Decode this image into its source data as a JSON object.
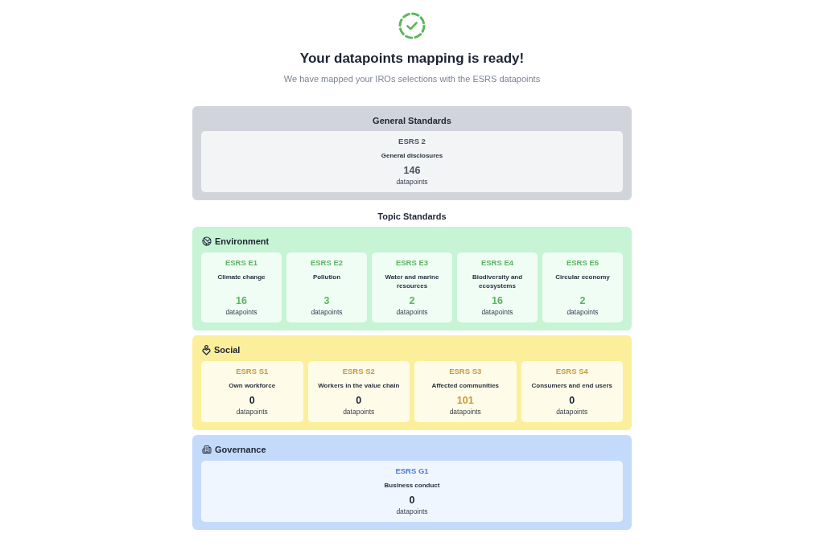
{
  "header": {
    "title": "Your datapoints mapping is ready!",
    "subtitle": "We have mapped your IROs selections with the ESRS datapoints"
  },
  "general_standards": {
    "title": "General Standards",
    "cards": [
      {
        "code": "ESRS 2",
        "label": "General disclosures",
        "count": "146",
        "unit": "datapoints",
        "highlighted": true
      }
    ]
  },
  "topic_standards": {
    "title": "Topic Standards",
    "sections": [
      {
        "kind": "environment",
        "title": "Environment",
        "cards": [
          {
            "code": "ESRS E1",
            "label": "Climate change",
            "count": "16",
            "unit": "datapoints",
            "highlighted": true
          },
          {
            "code": "ESRS E2",
            "label": "Pollution",
            "count": "3",
            "unit": "datapoints",
            "highlighted": true
          },
          {
            "code": "ESRS E3",
            "label": "Water and marine resources",
            "count": "2",
            "unit": "datapoints",
            "highlighted": true
          },
          {
            "code": "ESRS E4",
            "label": "Biodiversity and ecosystems",
            "count": "16",
            "unit": "datapoints",
            "highlighted": true
          },
          {
            "code": "ESRS E5",
            "label": "Circular economy",
            "count": "2",
            "unit": "datapoints",
            "highlighted": true
          }
        ]
      },
      {
        "kind": "social",
        "title": "Social",
        "cards": [
          {
            "code": "ESRS S1",
            "label": "Own workforce",
            "count": "0",
            "unit": "datapoints",
            "highlighted": false
          },
          {
            "code": "ESRS S2",
            "label": "Workers in the value chain",
            "count": "0",
            "unit": "datapoints",
            "highlighted": false
          },
          {
            "code": "ESRS S3",
            "label": "Affected communities",
            "count": "101",
            "unit": "datapoints",
            "highlighted": true
          },
          {
            "code": "ESRS S4",
            "label": "Consumers and end users",
            "count": "0",
            "unit": "datapoints",
            "highlighted": false
          }
        ]
      },
      {
        "kind": "governance",
        "title": "Governance",
        "cards": [
          {
            "code": "ESRS G1",
            "label": "Business conduct",
            "count": "0",
            "unit": "datapoints",
            "highlighted": false
          }
        ]
      }
    ]
  }
}
